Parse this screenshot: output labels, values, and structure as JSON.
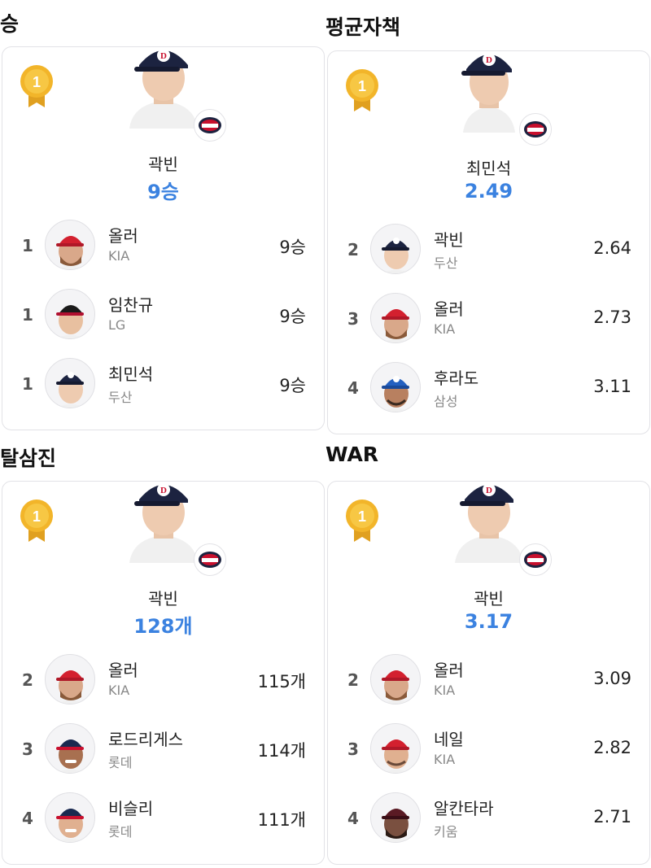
{
  "panels": [
    {
      "title": "승",
      "leader": {
        "rank": "1",
        "name": "곽빈",
        "value": "9승",
        "team_logo": "bears-logo"
      },
      "rows": [
        {
          "rank": "1",
          "name": "올러",
          "team": "KIA",
          "value": "9승",
          "cap": "kia-cap"
        },
        {
          "rank": "1",
          "name": "임찬규",
          "team": "LG",
          "value": "9승",
          "cap": "lg-cap"
        },
        {
          "rank": "1",
          "name": "최민석",
          "team": "두산",
          "value": "9승",
          "cap": "doosan-cap"
        }
      ]
    },
    {
      "title": "평균자책",
      "leader": {
        "rank": "1",
        "name": "최민석",
        "value": "2.49",
        "team_logo": "bears-logo"
      },
      "rows": [
        {
          "rank": "2",
          "name": "곽빈",
          "team": "두산",
          "value": "2.64",
          "cap": "doosan-cap"
        },
        {
          "rank": "3",
          "name": "올러",
          "team": "KIA",
          "value": "2.73",
          "cap": "kia-cap"
        },
        {
          "rank": "4",
          "name": "후라도",
          "team": "삼성",
          "value": "3.11",
          "cap": "samsung-cap"
        }
      ]
    },
    {
      "title": "탈삼진",
      "leader": {
        "rank": "1",
        "name": "곽빈",
        "value": "128개",
        "team_logo": "bears-logo"
      },
      "rows": [
        {
          "rank": "2",
          "name": "올러",
          "team": "KIA",
          "value": "115개",
          "cap": "kia-cap"
        },
        {
          "rank": "3",
          "name": "로드리게스",
          "team": "롯데",
          "value": "114개",
          "cap": "lotte-cap"
        },
        {
          "rank": "4",
          "name": "비슬리",
          "team": "롯데",
          "value": "111개",
          "cap": "lotte-cap"
        }
      ]
    },
    {
      "title": "WAR",
      "leader": {
        "rank": "1",
        "name": "곽빈",
        "value": "3.17",
        "team_logo": "bears-logo"
      },
      "rows": [
        {
          "rank": "2",
          "name": "올러",
          "team": "KIA",
          "value": "3.09",
          "cap": "kia-cap"
        },
        {
          "rank": "3",
          "name": "네일",
          "team": "KIA",
          "value": "2.82",
          "cap": "kia-cap"
        },
        {
          "rank": "4",
          "name": "알칸타라",
          "team": "키움",
          "value": "2.71",
          "cap": "kiwoom-cap"
        }
      ]
    }
  ],
  "colors": {
    "accent": "#3b82e0",
    "medal_gold": "#f2b52a",
    "ribbon": "#e0a020",
    "doosan_cap": "#1c2340",
    "kia_cap": "#d3202f",
    "lg_cap": "#b01030",
    "samsung_cap": "#2460c0",
    "lotte_cap": "#1a2a50",
    "kiwoom_cap": "#5a1a24"
  }
}
